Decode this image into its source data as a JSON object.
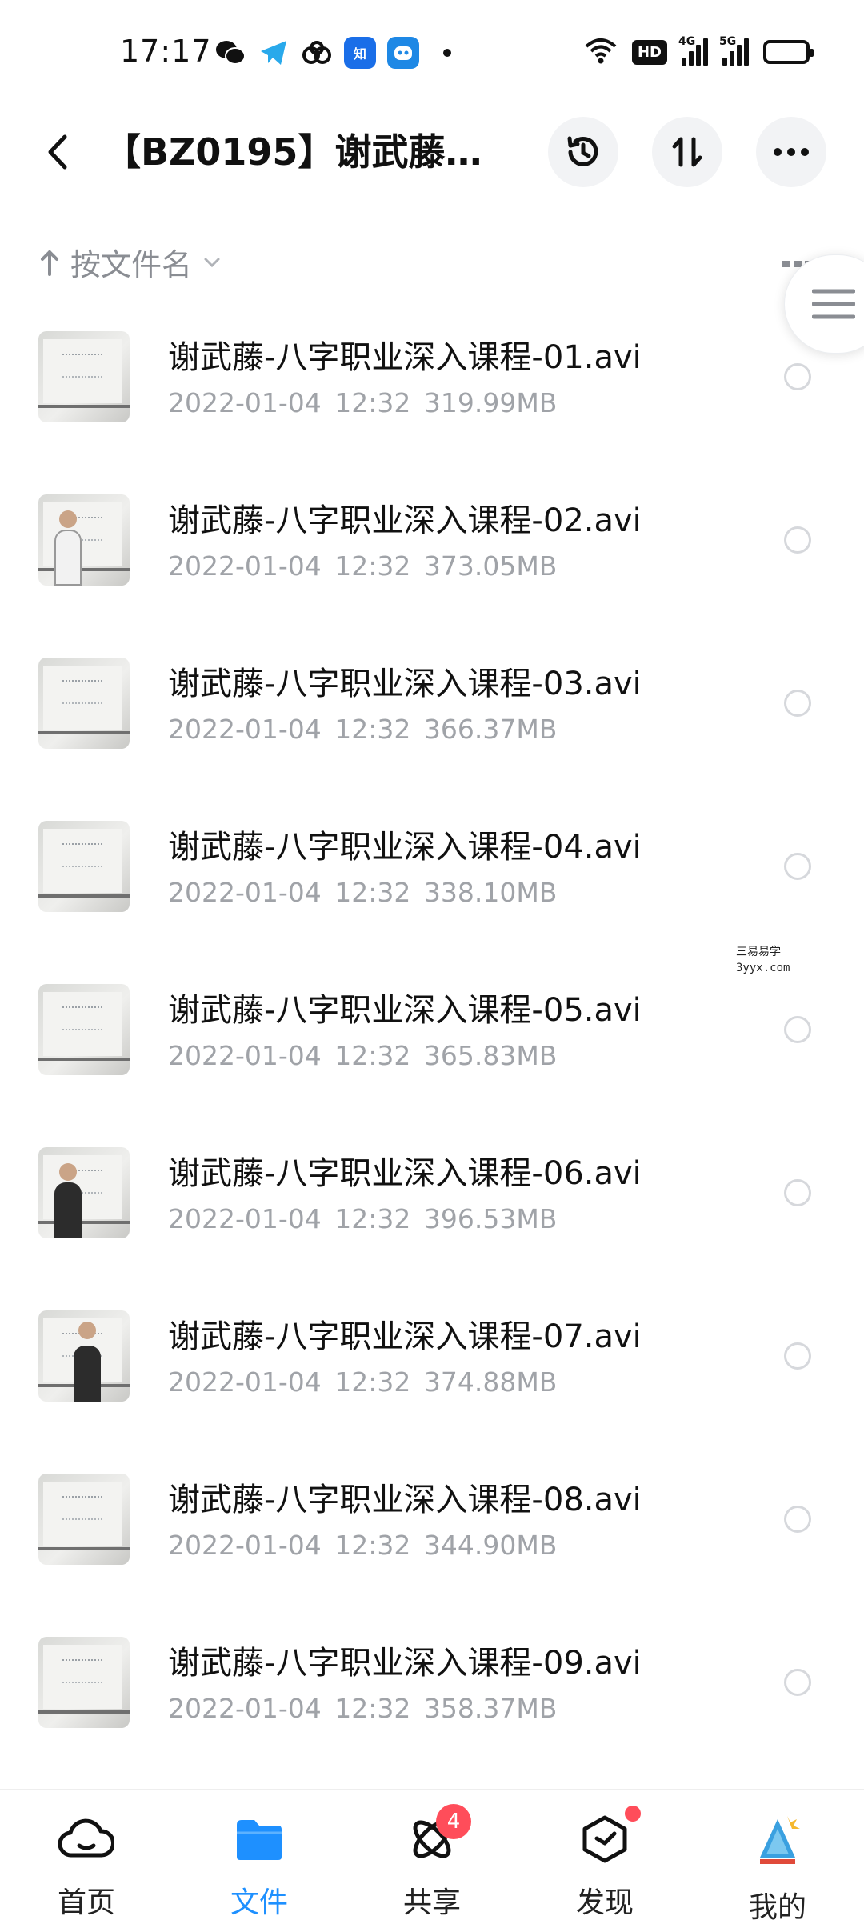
{
  "status_bar": {
    "time": "17:17",
    "hd_label": "HD",
    "network_1": "4G",
    "network_2": "5G"
  },
  "header": {
    "title": "【BZ0195】谢武藤-…",
    "history_icon": "history-icon",
    "sort_icon": "sort-icon",
    "more_icon": "more-icon"
  },
  "sort": {
    "label": "按文件名"
  },
  "files": [
    {
      "name": "谢武藤-八字职业深入课程-01.avi",
      "meta": "2022-01-04  12:32  319.99MB",
      "thumb": "board"
    },
    {
      "name": "谢武藤-八字职业深入课程-02.avi",
      "meta": "2022-01-04  12:32  373.05MB",
      "thumb": "teacher"
    },
    {
      "name": "谢武藤-八字职业深入课程-03.avi",
      "meta": "2022-01-04  12:32  366.37MB",
      "thumb": "board"
    },
    {
      "name": "谢武藤-八字职业深入课程-04.avi",
      "meta": "2022-01-04  12:32  338.10MB",
      "thumb": "board"
    },
    {
      "name": "谢武藤-八字职业深入课程-05.avi",
      "meta": "2022-01-04  12:32  365.83MB",
      "thumb": "board"
    },
    {
      "name": "谢武藤-八字职业深入课程-06.avi",
      "meta": "2022-01-04  12:32  396.53MB",
      "thumb": "teacher"
    },
    {
      "name": "谢武藤-八字职业深入课程-07.avi",
      "meta": "2022-01-04  12:32  374.88MB",
      "thumb": "teacher"
    },
    {
      "name": "谢武藤-八字职业深入课程-08.avi",
      "meta": "2022-01-04  12:32  344.90MB",
      "thumb": "board"
    },
    {
      "name": "谢武藤-八字职业深入课程-09.avi",
      "meta": "2022-01-04  12:32  358.37MB",
      "thumb": "board"
    }
  ],
  "watermark": {
    "line1": "三易易学",
    "line2": "3yyx.com"
  },
  "nav": {
    "items": [
      {
        "label": "首页",
        "icon": "cloud-home-icon",
        "active": false
      },
      {
        "label": "文件",
        "icon": "folder-icon",
        "active": true
      },
      {
        "label": "共享",
        "icon": "share-atom-icon",
        "active": false,
        "badge": "4"
      },
      {
        "label": "发现",
        "icon": "discover-box-icon",
        "active": false,
        "dot": true
      },
      {
        "label": "我的",
        "icon": "avatar",
        "active": false
      }
    ]
  },
  "colors": {
    "accent": "#1e90ff",
    "badge": "#ff4d5a",
    "meta_text": "#a0a3a8"
  }
}
